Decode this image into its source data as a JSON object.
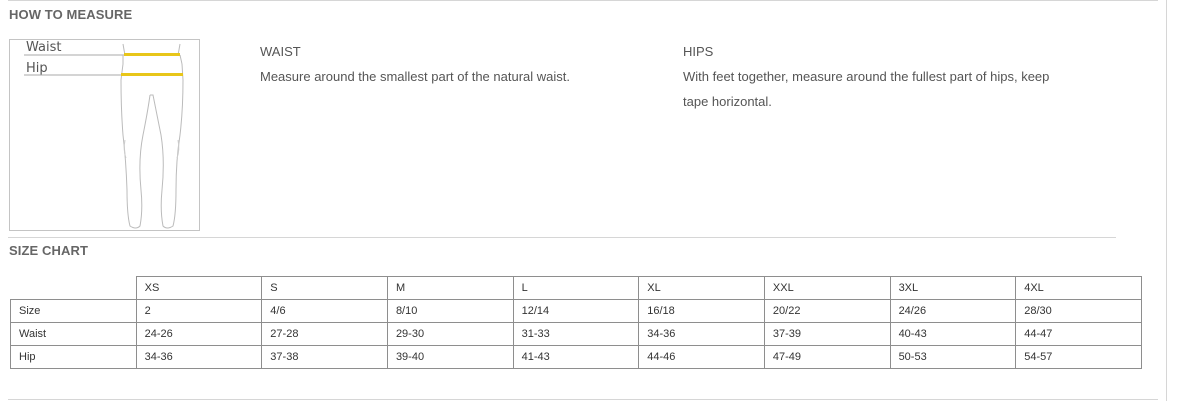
{
  "how_to_measure": {
    "title": "HOW TO MEASURE",
    "figure": {
      "waist_label": "Waist",
      "hip_label": "Hip"
    },
    "waist": {
      "title": "WAIST",
      "text": "Measure around the smallest part of the natural waist."
    },
    "hips": {
      "title": "HIPS",
      "line1": "With feet together, measure around the fullest part of hips, keep",
      "line2": "tape horizontal."
    }
  },
  "size_chart": {
    "title": "SIZE CHART",
    "columns": [
      "XS",
      "S",
      "M",
      "L",
      "XL",
      "XXL",
      "3XL",
      "4XL"
    ],
    "rows": [
      {
        "label": "Size",
        "values": [
          "2",
          "4/6",
          "8/10",
          "12/14",
          "16/18",
          "20/22",
          "24/26",
          "28/30"
        ]
      },
      {
        "label": "Waist",
        "values": [
          "24-26",
          "27-28",
          "29-30",
          "31-33",
          "34-36",
          "37-39",
          "40-43",
          "44-47"
        ]
      },
      {
        "label": "Hip",
        "values": [
          "34-36",
          "37-38",
          "39-40",
          "41-43",
          "44-46",
          "47-49",
          "50-53",
          "54-57"
        ]
      }
    ]
  },
  "colors": {
    "tape": "#e8c619",
    "rule": "#d6d6d6",
    "table_border": "#8e8e8e"
  }
}
